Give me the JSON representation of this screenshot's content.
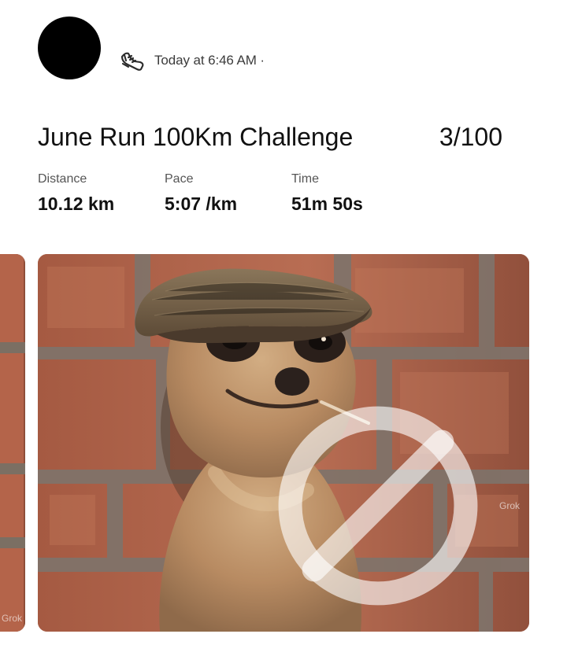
{
  "post": {
    "timestamp": "Today at 6:46 AM ·",
    "activity_icon": "running-shoe-icon"
  },
  "challenge": {
    "title": "June Run 100Km Challenge",
    "progress": "3/100"
  },
  "stats": [
    {
      "label": "Distance",
      "value": "10.12 km"
    },
    {
      "label": "Pace",
      "value": "5:07 /km"
    },
    {
      "label": "Time",
      "value": "51m 50s"
    }
  ],
  "photos": {
    "previous_watermark": "Grok",
    "main_watermark": "Grok"
  },
  "colors": {
    "avatar": "#000000",
    "text": "#111111",
    "muted_text": "#555555",
    "brick": "#a85a3f",
    "mortar": "#7b6f63"
  }
}
